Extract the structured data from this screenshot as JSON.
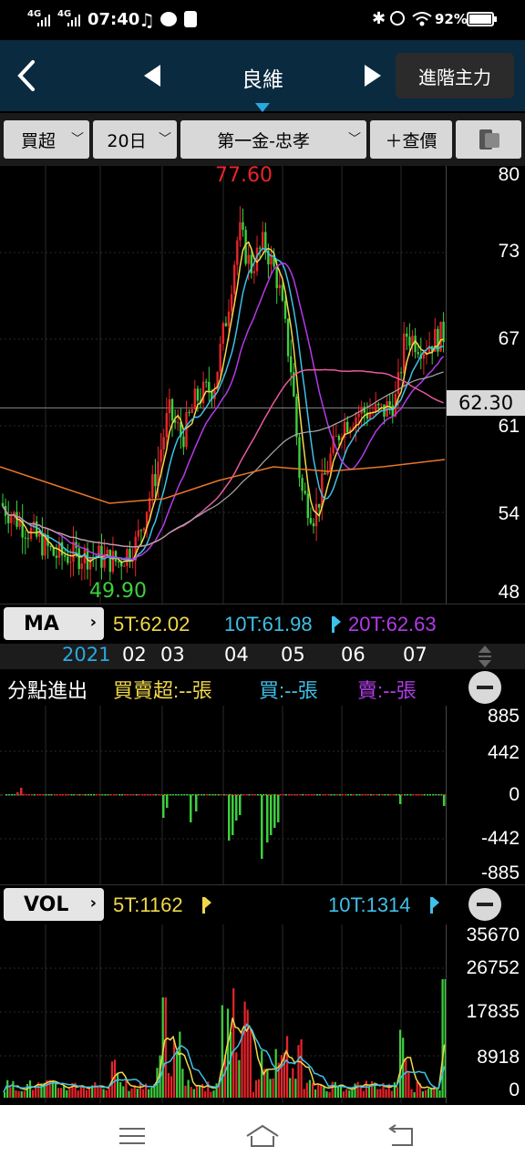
{
  "status": {
    "net1": "4G",
    "net2": "4G",
    "time": "07:40",
    "battery": "92%"
  },
  "nav": {
    "title": "良維",
    "advanced_label": "進階主力"
  },
  "controls": {
    "type": "買超",
    "period": "20日",
    "broker": "第一金-忠孝",
    "add_quote": "＋查價"
  },
  "price_chart": {
    "y_labels": [
      "80",
      "73",
      "67",
      "61",
      "54",
      "48"
    ],
    "current_price": "62.30",
    "high_label": "77.60",
    "low_label": "49.90"
  },
  "ma_bar": {
    "button": "MA",
    "ma5": "5T:62.02",
    "ma10": "10T:61.98",
    "ma20": "20T:62.63"
  },
  "time_axis": {
    "year": "2021",
    "months": [
      "02",
      "03",
      "04",
      "05",
      "06",
      "07"
    ]
  },
  "branch_bar": {
    "title": "分點進出",
    "net": "買賣超:--張",
    "buy": "買:--張",
    "sell": "賣:--張"
  },
  "branch_chart": {
    "y_labels": [
      "885",
      "442",
      "0",
      "-442",
      "-885"
    ]
  },
  "vol_bar": {
    "button": "VOL",
    "ma5": "5T:1162",
    "ma10": "10T:1314"
  },
  "vol_chart": {
    "y_labels": [
      "35670",
      "26752",
      "17835",
      "8918",
      "0"
    ]
  },
  "colors": {
    "up": "#e8242a",
    "down": "#3ecf3e",
    "ma5": "#f0d84a",
    "ma10": "#3fc0e8",
    "ma20": "#b23be8",
    "ma60": "#e85aa0",
    "ma120": "#aaaaaa",
    "ma240": "#e8762a"
  }
}
